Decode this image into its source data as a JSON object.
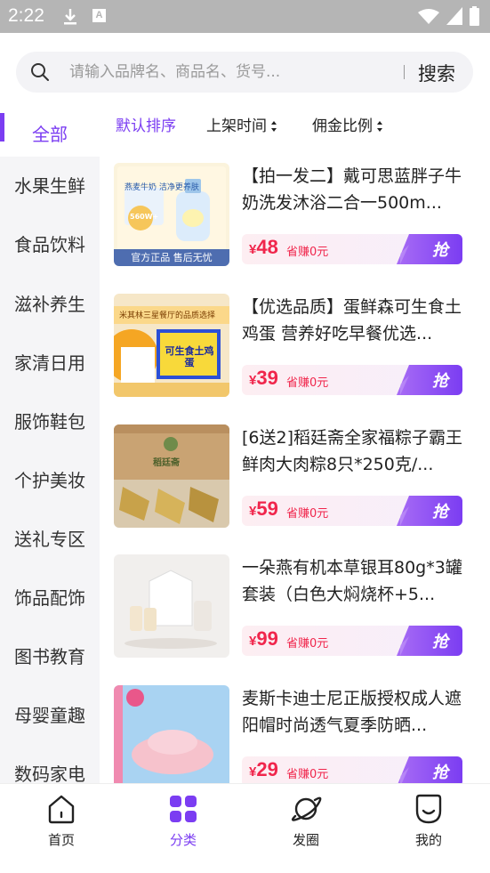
{
  "status_bar": {
    "time": "2:22",
    "a_icon": "A"
  },
  "search": {
    "placeholder": "请输入品牌名、商品名、货号...",
    "button": "搜索"
  },
  "sidebar": {
    "items": [
      {
        "label": "全部",
        "active": true
      },
      {
        "label": "水果生鲜"
      },
      {
        "label": "食品饮料"
      },
      {
        "label": "滋补养生"
      },
      {
        "label": "家清日用"
      },
      {
        "label": "服饰鞋包"
      },
      {
        "label": "个护美妆"
      },
      {
        "label": "送礼专区"
      },
      {
        "label": "饰品配饰"
      },
      {
        "label": "图书教育"
      },
      {
        "label": "母婴童趣"
      },
      {
        "label": "数码家电"
      }
    ]
  },
  "sort": {
    "default": "默认排序",
    "time": "上架时间",
    "commission": "佣金比例"
  },
  "products": [
    {
      "title": "【拍一发二】戴可思蓝胖子牛奶洗发沐浴二合一500m...",
      "currency": "¥",
      "price": "48",
      "save": "省赚0元",
      "grab": "抢",
      "image": {
        "badge": "官方正品 售后无忧",
        "label": "燕麦牛奶 洁净更养肤",
        "big": "560W+"
      }
    },
    {
      "title": "【优选品质】蛋鲜森可生食土鸡蛋 营养好吃早餐优选...",
      "currency": "¥",
      "price": "39",
      "save": "省赚0元",
      "grab": "抢",
      "image": {
        "banner": "米其林三星餐厅的品质选择",
        "box": "可生食土鸡蛋"
      }
    },
    {
      "title": "[6送2]稻廷斋全家福粽子霸王鲜肉大肉粽8只*250克/...",
      "currency": "¥",
      "price": "59",
      "save": "省赚0元",
      "grab": "抢",
      "image": {
        "box": "稻廷斋"
      }
    },
    {
      "title": "一朵燕有机本草银耳80g*3罐套装（白色大焖烧杯+5...",
      "currency": "¥",
      "price": "99",
      "save": "省赚0元",
      "grab": "抢",
      "image": {}
    },
    {
      "title": "麦斯卡迪士尼正版授权成人遮阳帽时尚透气夏季防晒...",
      "currency": "¥",
      "price": "29",
      "save": "省赚0元",
      "grab": "抢",
      "image": {}
    }
  ],
  "bottom_nav": [
    {
      "label": "首页",
      "icon": "home-icon"
    },
    {
      "label": "分类",
      "icon": "category-icon",
      "active": true
    },
    {
      "label": "发圈",
      "icon": "planet-icon"
    },
    {
      "label": "我的",
      "icon": "profile-icon"
    }
  ],
  "colors": {
    "accent": "#7b3df2",
    "price": "#f0264c",
    "statusbar": "#b5b5b5"
  }
}
